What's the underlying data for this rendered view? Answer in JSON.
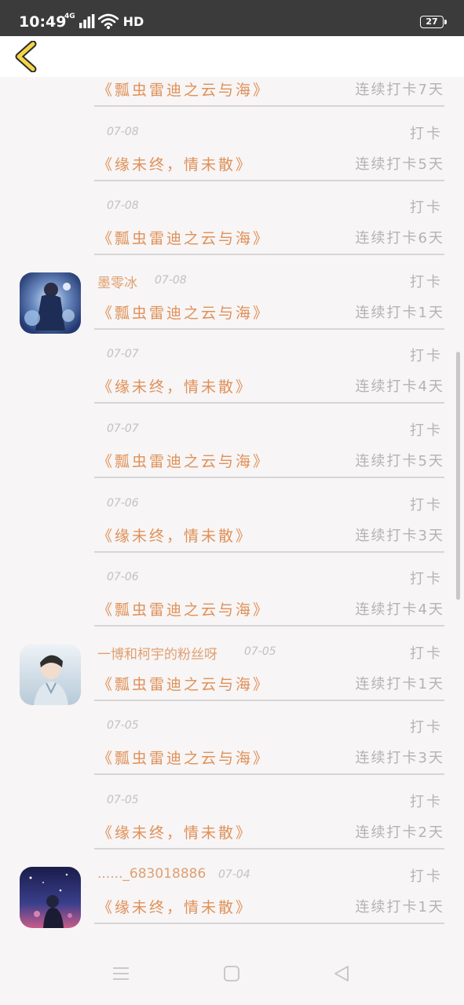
{
  "status_bar": {
    "time": "10:49",
    "network": "4G",
    "wifi_label": "HD",
    "battery": "27"
  },
  "header": {
    "back_icon": "chevron-left-icon"
  },
  "entries": [
    {
      "username": "",
      "date": "",
      "punch_label": "",
      "book": "《瓢虫雷迪之云与海》",
      "streak": "连续打卡7天",
      "avatar": ""
    },
    {
      "username": "",
      "date": "07-08",
      "punch_label": "打卡",
      "book": "《缘未终，情未散》",
      "streak": "连续打卡5天",
      "avatar": ""
    },
    {
      "username": "",
      "date": "07-08",
      "punch_label": "打卡",
      "book": "《瓢虫雷迪之云与海》",
      "streak": "连续打卡6天",
      "avatar": ""
    },
    {
      "username": "墨零冰",
      "date": "07-08",
      "punch_label": "打卡",
      "book": "《瓢虫雷迪之云与海》",
      "streak": "连续打卡1天",
      "avatar": "blue-anime-avatar"
    },
    {
      "username": "",
      "date": "07-07",
      "punch_label": "打卡",
      "book": "《缘未终，情未散》",
      "streak": "连续打卡4天",
      "avatar": ""
    },
    {
      "username": "",
      "date": "07-07",
      "punch_label": "打卡",
      "book": "《瓢虫雷迪之云与海》",
      "streak": "连续打卡5天",
      "avatar": ""
    },
    {
      "username": "",
      "date": "07-06",
      "punch_label": "打卡",
      "book": "《缘未终，情未散》",
      "streak": "连续打卡3天",
      "avatar": ""
    },
    {
      "username": "",
      "date": "07-06",
      "punch_label": "打卡",
      "book": "《瓢虫雷迪之云与海》",
      "streak": "连续打卡4天",
      "avatar": ""
    },
    {
      "username": "一博和柯宇的粉丝呀",
      "date": "07-05",
      "punch_label": "打卡",
      "book": "《瓢虫雷迪之云与海》",
      "streak": "连续打卡1天",
      "avatar": "light-portrait-avatar"
    },
    {
      "username": "",
      "date": "07-05",
      "punch_label": "打卡",
      "book": "《瓢虫雷迪之云与海》",
      "streak": "连续打卡3天",
      "avatar": ""
    },
    {
      "username": "",
      "date": "07-05",
      "punch_label": "打卡",
      "book": "《缘未终，情未散》",
      "streak": "连续打卡2天",
      "avatar": ""
    },
    {
      "username": "......_683018886",
      "date": "07-04",
      "punch_label": "打卡",
      "book": "《缘未终，情未散》",
      "streak": "连续打卡1天",
      "avatar": "night-sky-avatar"
    }
  ],
  "nav_bar": {
    "menu_icon": "menu-icon",
    "home_icon": "home-square-icon",
    "back_icon": "back-triangle-icon"
  },
  "colors": {
    "accent": "#e09058",
    "muted": "#b3b3b3",
    "status_bar_bg": "#3b3b3b",
    "page_bg": "#f7f5f5",
    "back_chevron": "#f5d547"
  }
}
